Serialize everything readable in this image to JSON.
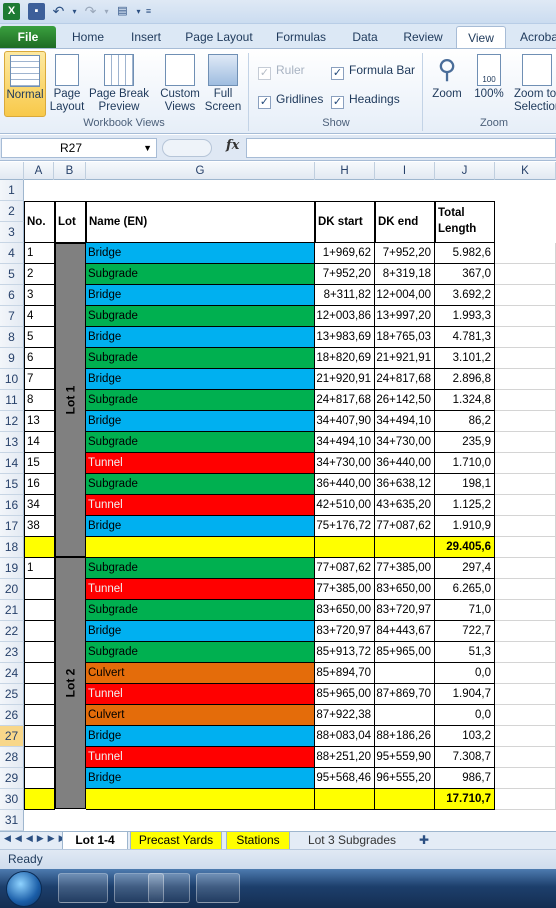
{
  "window": {
    "app": "Microsoft Excel"
  },
  "tabs": [
    "File",
    "Home",
    "Insert",
    "Page Layout",
    "Formulas",
    "Data",
    "Review",
    "View",
    "Acrobat"
  ],
  "active_tab": "View",
  "ribbon": {
    "workbook_views": {
      "label": "Workbook Views",
      "buttons": [
        "Normal",
        "Page Layout",
        "Page Break Preview",
        "Custom Views",
        "Full Screen"
      ]
    },
    "show": {
      "label": "Show",
      "ruler": "Ruler",
      "gridlines": "Gridlines",
      "formula_bar": "Formula Bar",
      "headings": "Headings"
    },
    "zoom": {
      "label": "Zoom",
      "zoom": "Zoom",
      "pct": "100%",
      "zoom_selection": "Zoom to Selection"
    }
  },
  "namebox": "R27",
  "fx": "fx",
  "columns": [
    "A",
    "B",
    "G",
    "H",
    "I",
    "J",
    "K"
  ],
  "headers": {
    "no": "No.",
    "lot": "Lot",
    "name": "Name (EN)",
    "dk_start": "DK start",
    "dk_end": "DK end",
    "total": "Total",
    "length": "Length"
  },
  "lots": {
    "lot1": "Lot 1",
    "lot2": "Lot 2"
  },
  "colors": {
    "Bridge": "#00b0f0",
    "Subgrade": "#00b050",
    "Tunnel": "#ff0000",
    "Culvert": "#e46c0a",
    "total": "#ffff00"
  },
  "rows": [
    {
      "r": "4",
      "no": "1",
      "name": "Bridge",
      "start": "1+969,62",
      "end": "7+952,20",
      "len": "5.982,6"
    },
    {
      "r": "5",
      "no": "2",
      "name": "Subgrade",
      "start": "7+952,20",
      "end": "8+319,18",
      "len": "367,0"
    },
    {
      "r": "6",
      "no": "3",
      "name": "Bridge",
      "start": "8+311,82",
      "end": "12+004,00",
      "len": "3.692,2"
    },
    {
      "r": "7",
      "no": "4",
      "name": "Subgrade",
      "start": "12+003,86",
      "end": "13+997,20",
      "len": "1.993,3"
    },
    {
      "r": "8",
      "no": "5",
      "name": "Bridge",
      "start": "13+983,69",
      "end": "18+765,03",
      "len": "4.781,3"
    },
    {
      "r": "9",
      "no": "6",
      "name": "Subgrade",
      "start": "18+820,69",
      "end": "21+921,91",
      "len": "3.101,2"
    },
    {
      "r": "10",
      "no": "7",
      "name": "Bridge",
      "start": "21+920,91",
      "end": "24+817,68",
      "len": "2.896,8"
    },
    {
      "r": "11",
      "no": "8",
      "name": "Subgrade",
      "start": "24+817,68",
      "end": "26+142,50",
      "len": "1.324,8"
    },
    {
      "r": "12",
      "no": "13",
      "name": "Bridge",
      "start": "34+407,90",
      "end": "34+494,10",
      "len": "86,2"
    },
    {
      "r": "13",
      "no": "14",
      "name": "Subgrade",
      "start": "34+494,10",
      "end": "34+730,00",
      "len": "235,9"
    },
    {
      "r": "14",
      "no": "15",
      "name": "Tunnel",
      "start": "34+730,00",
      "end": "36+440,00",
      "len": "1.710,0"
    },
    {
      "r": "15",
      "no": "16",
      "name": "Subgrade",
      "start": "36+440,00",
      "end": "36+638,12",
      "len": "198,1"
    },
    {
      "r": "16",
      "no": "34",
      "name": "Tunnel",
      "start": "42+510,00",
      "end": "43+635,20",
      "len": "1.125,2"
    },
    {
      "r": "17",
      "no": "38",
      "name": "Bridge",
      "start": "75+176,72",
      "end": "77+087,62",
      "len": "1.910,9"
    },
    {
      "r": "18",
      "no": "",
      "name": "",
      "start": "",
      "end": "",
      "len": "29.405,6",
      "total": true
    },
    {
      "r": "19",
      "no": "1",
      "name": "Subgrade",
      "start": "77+087,62",
      "end": "77+385,00",
      "len": "297,4"
    },
    {
      "r": "20",
      "no": "",
      "name": "Tunnel",
      "start": "77+385,00",
      "end": "83+650,00",
      "len": "6.265,0"
    },
    {
      "r": "21",
      "no": "",
      "name": "Subgrade",
      "start": "83+650,00",
      "end": "83+720,97",
      "len": "71,0"
    },
    {
      "r": "22",
      "no": "",
      "name": "Bridge",
      "start": "83+720,97",
      "end": "84+443,67",
      "len": "722,7"
    },
    {
      "r": "23",
      "no": "",
      "name": "Subgrade",
      "start": "85+913,72",
      "end": "85+965,00",
      "len": "51,3"
    },
    {
      "r": "24",
      "no": "",
      "name": "Culvert",
      "start": "85+894,70",
      "end": "",
      "len": "0,0"
    },
    {
      "r": "25",
      "no": "",
      "name": "Tunnel",
      "start": "85+965,00",
      "end": "87+869,70",
      "len": "1.904,7"
    },
    {
      "r": "26",
      "no": "",
      "name": "Culvert",
      "start": "87+922,38",
      "end": "",
      "len": "0,0"
    },
    {
      "r": "27",
      "no": "",
      "name": "Bridge",
      "start": "88+083,04",
      "end": "88+186,26",
      "len": "103,2"
    },
    {
      "r": "28",
      "no": "",
      "name": "Tunnel",
      "start": "88+251,20",
      "end": "95+559,90",
      "len": "7.308,7"
    },
    {
      "r": "29",
      "no": "",
      "name": "Bridge",
      "start": "95+568,46",
      "end": "96+555,20",
      "len": "986,7"
    },
    {
      "r": "30",
      "no": "",
      "name": "",
      "start": "",
      "end": "",
      "len": "17.710,7",
      "total": true
    }
  ],
  "sheet_tabs": [
    "Lot 1-4",
    "Precast Yards",
    "Stations",
    "Lot 3 Subgrades"
  ],
  "status": "Ready"
}
